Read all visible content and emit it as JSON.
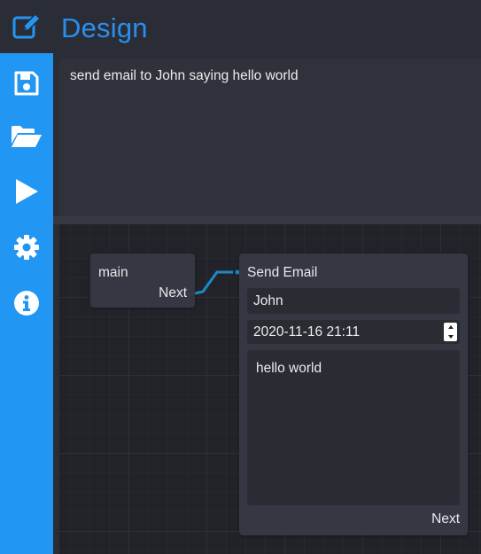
{
  "sidebar": {
    "items": [
      {
        "name": "design",
        "icon": "edit-icon",
        "active": true
      },
      {
        "name": "save",
        "icon": "save-icon"
      },
      {
        "name": "open",
        "icon": "folder-open-icon"
      },
      {
        "name": "run",
        "icon": "play-icon"
      },
      {
        "name": "settings",
        "icon": "gear-icon"
      },
      {
        "name": "about",
        "icon": "info-icon"
      }
    ],
    "accent": "#2196f3"
  },
  "header": {
    "title": "Design",
    "title_color": "#2a8ef0"
  },
  "prompt": {
    "text": "send email to John saying hello world"
  },
  "canvas": {
    "nodes": {
      "main": {
        "title": "main",
        "output": "Next"
      },
      "send_email": {
        "title": "Send Email",
        "to": "John",
        "datetime": "2020-11-16 21:11",
        "body": "hello world",
        "output": "Next"
      }
    },
    "wire_color": "#1e88c8"
  }
}
